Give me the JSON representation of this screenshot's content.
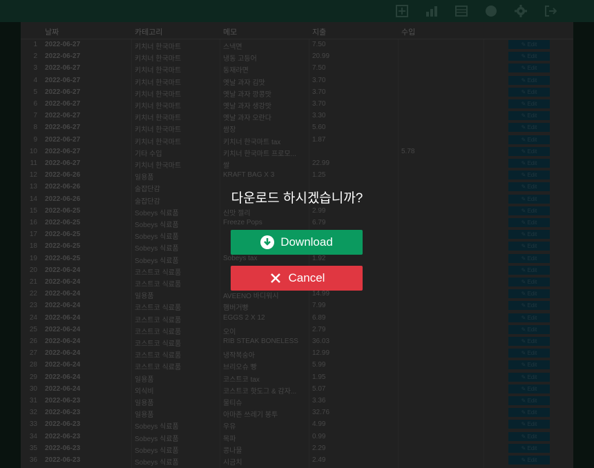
{
  "toolbar": {
    "icons": [
      "add-icon",
      "chart-icon",
      "table-icon",
      "circle-icon",
      "gear-icon",
      "logout-icon"
    ]
  },
  "table": {
    "headers": {
      "date": "날짜",
      "category": "카테고리",
      "memo": "메모",
      "expense": "지출",
      "income": "수입"
    },
    "edit_label": "✎ Edit",
    "rows": [
      {
        "n": "1",
        "date": "2022-06-27",
        "cat": "키치너 한국마트",
        "memo": "스낵면",
        "exp": "7.50",
        "inc": ""
      },
      {
        "n": "2",
        "date": "2022-06-27",
        "cat": "키치너 한국마트",
        "memo": "냉동 고등어",
        "exp": "20.99",
        "inc": ""
      },
      {
        "n": "3",
        "date": "2022-06-27",
        "cat": "키치너 한국마트",
        "memo": "동재라면",
        "exp": "7.50",
        "inc": ""
      },
      {
        "n": "4",
        "date": "2022-06-27",
        "cat": "키치너 한국마트",
        "memo": "옛날 과자 김맛",
        "exp": "3.70",
        "inc": ""
      },
      {
        "n": "5",
        "date": "2022-06-27",
        "cat": "키치너 한국마트",
        "memo": "옛날 과자 깡콩맛",
        "exp": "3.70",
        "inc": ""
      },
      {
        "n": "6",
        "date": "2022-06-27",
        "cat": "키치너 한국마트",
        "memo": "옛날 과자 생강맛",
        "exp": "3.70",
        "inc": ""
      },
      {
        "n": "7",
        "date": "2022-06-27",
        "cat": "키치너 한국마트",
        "memo": "옛날 과자 오란다",
        "exp": "3.30",
        "inc": ""
      },
      {
        "n": "8",
        "date": "2022-06-27",
        "cat": "키치너 한국마트",
        "memo": "쌈장",
        "exp": "5.60",
        "inc": ""
      },
      {
        "n": "9",
        "date": "2022-06-27",
        "cat": "키치너 한국마트",
        "memo": "키치너 한국마트 tax",
        "exp": "1.87",
        "inc": ""
      },
      {
        "n": "10",
        "date": "2022-06-27",
        "cat": "기타 수입",
        "memo": "키치너 한국마트 프로모...",
        "exp": "",
        "inc": "5.78"
      },
      {
        "n": "11",
        "date": "2022-06-27",
        "cat": "키치너 한국마트",
        "memo": "쌀",
        "exp": "22.99",
        "inc": ""
      },
      {
        "n": "12",
        "date": "2022-06-26",
        "cat": "일용품",
        "memo": "KRAFT BAG X 3",
        "exp": "1.25",
        "inc": ""
      },
      {
        "n": "13",
        "date": "2022-06-26",
        "cat": "술잡단감",
        "memo": "",
        "exp": "",
        "inc": ""
      },
      {
        "n": "14",
        "date": "2022-06-26",
        "cat": "술잡단감",
        "memo": "",
        "exp": "",
        "inc": ""
      },
      {
        "n": "15",
        "date": "2022-06-25",
        "cat": "Sobeys 식료품",
        "memo": "신맛 젤리",
        "exp": "2.99",
        "inc": ""
      },
      {
        "n": "16",
        "date": "2022-06-25",
        "cat": "Sobeys 식료품",
        "memo": "Freeze Pops",
        "exp": "6.79",
        "inc": ""
      },
      {
        "n": "17",
        "date": "2022-06-25",
        "cat": "Sobeys 식료품",
        "memo": "",
        "exp": "",
        "inc": ""
      },
      {
        "n": "18",
        "date": "2022-06-25",
        "cat": "Sobeys 식료품",
        "memo": "",
        "exp": "",
        "inc": ""
      },
      {
        "n": "19",
        "date": "2022-06-25",
        "cat": "Sobeys 식료품",
        "memo": "Sobeys tax",
        "exp": "1.92",
        "inc": ""
      },
      {
        "n": "20",
        "date": "2022-06-24",
        "cat": "코스트코 식료품",
        "memo": "",
        "exp": "",
        "inc": ""
      },
      {
        "n": "21",
        "date": "2022-06-24",
        "cat": "코스트코 식료품",
        "memo": "",
        "exp": "",
        "inc": ""
      },
      {
        "n": "22",
        "date": "2022-06-24",
        "cat": "일용품",
        "memo": "AVEENO 바디워시",
        "exp": "14.99",
        "inc": ""
      },
      {
        "n": "23",
        "date": "2022-06-24",
        "cat": "코스트코 식료품",
        "memo": "햄버거빵",
        "exp": "7.99",
        "inc": ""
      },
      {
        "n": "24",
        "date": "2022-06-24",
        "cat": "코스트코 식료품",
        "memo": "EGGS 2 X 12",
        "exp": "6.89",
        "inc": ""
      },
      {
        "n": "25",
        "date": "2022-06-24",
        "cat": "코스트코 식료품",
        "memo": "오이",
        "exp": "2.79",
        "inc": ""
      },
      {
        "n": "26",
        "date": "2022-06-24",
        "cat": "코스트코 식료품",
        "memo": "RIB STEAK BONELESS",
        "exp": "36.03",
        "inc": ""
      },
      {
        "n": "27",
        "date": "2022-06-24",
        "cat": "코스트코 식료품",
        "memo": "냉작복숭아",
        "exp": "12.99",
        "inc": ""
      },
      {
        "n": "28",
        "date": "2022-06-24",
        "cat": "코스트코 식료품",
        "memo": "브리오슈 빵",
        "exp": "5.99",
        "inc": ""
      },
      {
        "n": "29",
        "date": "2022-06-24",
        "cat": "일용품",
        "memo": "코스트코 tax",
        "exp": "1.95",
        "inc": ""
      },
      {
        "n": "30",
        "date": "2022-06-24",
        "cat": "외식비",
        "memo": "코스트코 핫도그 & 감자...",
        "exp": "5.07",
        "inc": ""
      },
      {
        "n": "31",
        "date": "2022-06-23",
        "cat": "일용품",
        "memo": "물티슈",
        "exp": "3.36",
        "inc": ""
      },
      {
        "n": "32",
        "date": "2022-06-23",
        "cat": "일용품",
        "memo": "아마존 쓰레기 봉투",
        "exp": "32.76",
        "inc": ""
      },
      {
        "n": "33",
        "date": "2022-06-23",
        "cat": "Sobeys 식료품",
        "memo": "우유",
        "exp": "4.99",
        "inc": ""
      },
      {
        "n": "34",
        "date": "2022-06-23",
        "cat": "Sobeys 식료품",
        "memo": "목파",
        "exp": "0.99",
        "inc": ""
      },
      {
        "n": "35",
        "date": "2022-06-23",
        "cat": "Sobeys 식료품",
        "memo": "콩나물",
        "exp": "2.29",
        "inc": ""
      },
      {
        "n": "36",
        "date": "2022-06-23",
        "cat": "Sobeys 식료품",
        "memo": "시금치",
        "exp": "2.49",
        "inc": ""
      }
    ]
  },
  "modal": {
    "title": "다운로드 하시겠습니까?",
    "download_label": "Download",
    "cancel_label": "Cancel",
    "download_color": "#0b9a5f",
    "cancel_color": "#e03741"
  }
}
